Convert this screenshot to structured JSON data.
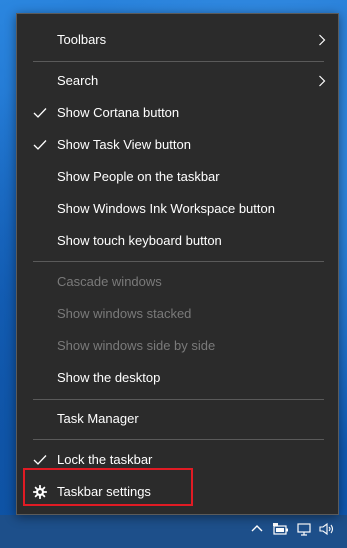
{
  "menu": {
    "items": [
      {
        "label": "Toolbars",
        "checked": false,
        "submenu": true,
        "disabled": false
      },
      {
        "label": "Search",
        "checked": false,
        "submenu": true,
        "disabled": false
      },
      {
        "label": "Show Cortana button",
        "checked": true,
        "submenu": false,
        "disabled": false
      },
      {
        "label": "Show Task View button",
        "checked": true,
        "submenu": false,
        "disabled": false
      },
      {
        "label": "Show People on the taskbar",
        "checked": false,
        "submenu": false,
        "disabled": false
      },
      {
        "label": "Show Windows Ink Workspace button",
        "checked": false,
        "submenu": false,
        "disabled": false
      },
      {
        "label": "Show touch keyboard button",
        "checked": false,
        "submenu": false,
        "disabled": false
      },
      {
        "label": "Cascade windows",
        "checked": false,
        "submenu": false,
        "disabled": true
      },
      {
        "label": "Show windows stacked",
        "checked": false,
        "submenu": false,
        "disabled": true
      },
      {
        "label": "Show windows side by side",
        "checked": false,
        "submenu": false,
        "disabled": true
      },
      {
        "label": "Show the desktop",
        "checked": false,
        "submenu": false,
        "disabled": false
      },
      {
        "label": "Task Manager",
        "checked": false,
        "submenu": false,
        "disabled": false
      },
      {
        "label": "Lock the taskbar",
        "checked": true,
        "submenu": false,
        "disabled": false
      },
      {
        "label": "Taskbar settings",
        "checked": false,
        "submenu": false,
        "disabled": false,
        "icon": "gear-icon",
        "highlighted": true
      }
    ]
  },
  "colors": {
    "menu_background": "#2b2b2b",
    "menu_text": "#ffffff",
    "disabled_text": "#7a7a7a",
    "separator": "#5a5a5a",
    "highlight_box": "#e01b24",
    "desktop": "#1766c2",
    "taskbar": "#1d4f8a"
  },
  "taskbar": {
    "tray_icons": [
      "chevron-up-icon",
      "battery-icon",
      "network-icon",
      "volume-icon"
    ]
  }
}
